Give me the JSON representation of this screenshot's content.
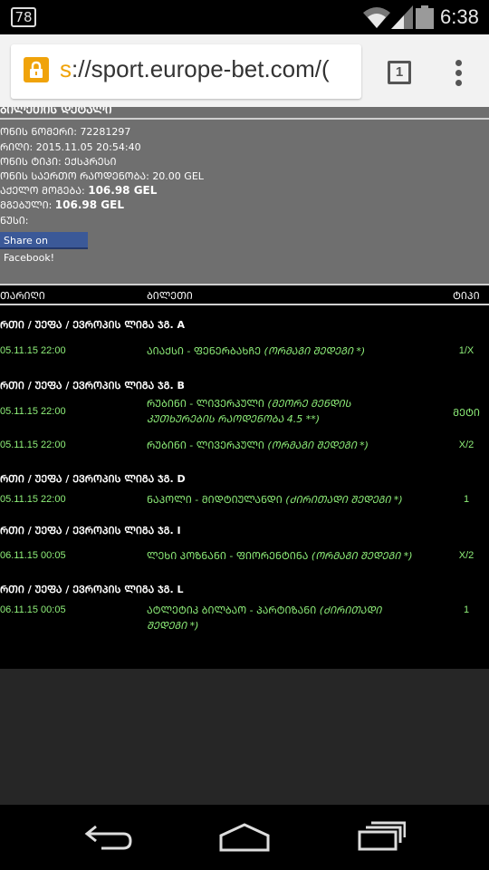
{
  "status_bar": {
    "notification_badge": "78",
    "time": "6:38",
    "icons": [
      "notification-icon",
      "wifi-icon",
      "signal-icon",
      "battery-icon"
    ]
  },
  "browser": {
    "url_scheme": "s",
    "url_rest": "://sport.europe-bet.com/(",
    "tab_count": "1",
    "accent_color": "#f0a30a"
  },
  "ticket": {
    "cut_title": "ᲑᲘᲚᲔᲗᲘᲡ ᲓᲔᲢᲐᲚᲘ",
    "number_label": "ᲝᲜᲘᲡ ᲜᲝᲛᲔᲠᲘ: ",
    "number_value": "72281297",
    "date_label": "ᲠᲘᲦᲘ: ",
    "date_value": "2015.11.05 20:54:40",
    "type_label": "ᲝᲜᲘᲡ ᲢᲘᲞᲘ: ",
    "type_value": "ᲔᲥᲡᲞᲠᲔᲡᲘ",
    "amount_label": "ᲝᲜᲘᲡ ᲡᲐᲔᲠᲗᲝ ᲠᲐᲝᲓᲔᲜᲝᲑᲐ: ",
    "amount_value": "20.00 GEL",
    "possible_win_label": "ᲐᲥᲔᲚᲝ ᲛᲝᲒᲔᲑᲐ: ",
    "possible_win_value": "106.98 GEL",
    "win_label": "ᲛᲒᲔᲑᲣᲚᲘ: ",
    "win_value": "106.98 GEL",
    "bonus_label": "ᲜᲣᲡᲘ:",
    "share_button": "Share on Facebook!"
  },
  "table": {
    "headers": [
      "ᲗᲐᲠᲘᲦᲘ",
      "ᲑᲘᲚᲔᲗᲘ",
      "ᲢᲘᲞᲘ"
    ],
    "groups": [
      {
        "title": "ᲠᲗᲘ / ᲣᲔᲤᲐ / ᲔᲕᲠᲝᲞᲘᲡ ᲚᲘᲒᲐ ᲯᲒ. A",
        "bets": [
          {
            "date": "05.11.15 22:00",
            "event": "ᲐᲘᲐᲥᲡᲘ - ᲤᲔᲜᲔᲠᲑᲐᲮᲩᲔ ",
            "market": "(ᲝᲠᲛᲐᲒᲘ ᲨᲔᲓᲔᲒᲘ *)",
            "type": "1/X"
          }
        ]
      },
      {
        "title": "ᲠᲗᲘ / ᲣᲔᲤᲐ / ᲔᲕᲠᲝᲞᲘᲡ ᲚᲘᲒᲐ ᲯᲒ. B",
        "bets": [
          {
            "date": "05.11.15 22:00",
            "event": "ᲠᲣᲑᲘᲜᲘ - ᲚᲘᲕᲔᲠᲞᲣᲚᲘ ",
            "market": "(ᲛᲔᲝᲠᲔ ᲛᲔᲜᲓᲘᲡ ᲙᲣᲗᲮᲣᲠᲔᲑᲘᲡ ᲠᲐᲝᲓᲔᲜᲝᲑᲐ 4.5 **)",
            "type": "ᲛᲔᲢᲘ"
          },
          {
            "date": "05.11.15 22:00",
            "event": "ᲠᲣᲑᲘᲜᲘ - ᲚᲘᲕᲔᲠᲞᲣᲚᲘ ",
            "market": "(ᲝᲠᲛᲐᲒᲘ ᲨᲔᲓᲔᲒᲘ *)",
            "type": "X/2"
          }
        ]
      },
      {
        "title": "ᲠᲗᲘ / ᲣᲔᲤᲐ / ᲔᲕᲠᲝᲞᲘᲡ ᲚᲘᲒᲐ ᲯᲒ. D",
        "bets": [
          {
            "date": "05.11.15 22:00",
            "event": "ᲜᲐᲞᲝᲚᲘ - ᲛᲘᲓᲢᲘᲣᲚᲐᲜᲓᲘ ",
            "market": "(ᲫᲘᲠᲘᲗᲐᲓᲘ ᲨᲔᲓᲔᲒᲘ *)",
            "type": "1"
          }
        ]
      },
      {
        "title": "ᲠᲗᲘ / ᲣᲔᲤᲐ / ᲔᲕᲠᲝᲞᲘᲡ ᲚᲘᲒᲐ ᲯᲒ. I",
        "bets": [
          {
            "date": "06.11.15 00:05",
            "event": "ᲚᲔᲮᲘ ᲞᲝᲖᲜᲐᲜᲘ - ᲤᲘᲝᲠᲔᲜᲢᲘᲜᲐ ",
            "market": "(ᲝᲠᲛᲐᲒᲘ ᲨᲔᲓᲔᲒᲘ *)",
            "type": "X/2"
          }
        ]
      },
      {
        "title": "ᲠᲗᲘ / ᲣᲔᲤᲐ / ᲔᲕᲠᲝᲞᲘᲡ ᲚᲘᲒᲐ ᲯᲒ. L",
        "bets": [
          {
            "date": "06.11.15 00:05",
            "event": "ᲐᲢᲚᲔᲢᲘᲙ ᲑᲘᲚᲑᲐᲝ - ᲞᲐᲠᲢᲘᲖᲐᲜᲘ ",
            "market": "(ᲫᲘᲠᲘᲗᲐᲓᲘ ᲨᲔᲓᲔᲒᲘ *)",
            "type": "1"
          }
        ]
      }
    ],
    "bet_color": "#8ff07a"
  },
  "nav_bar": {
    "icons": [
      "back-icon",
      "home-icon",
      "recents-icon"
    ]
  }
}
